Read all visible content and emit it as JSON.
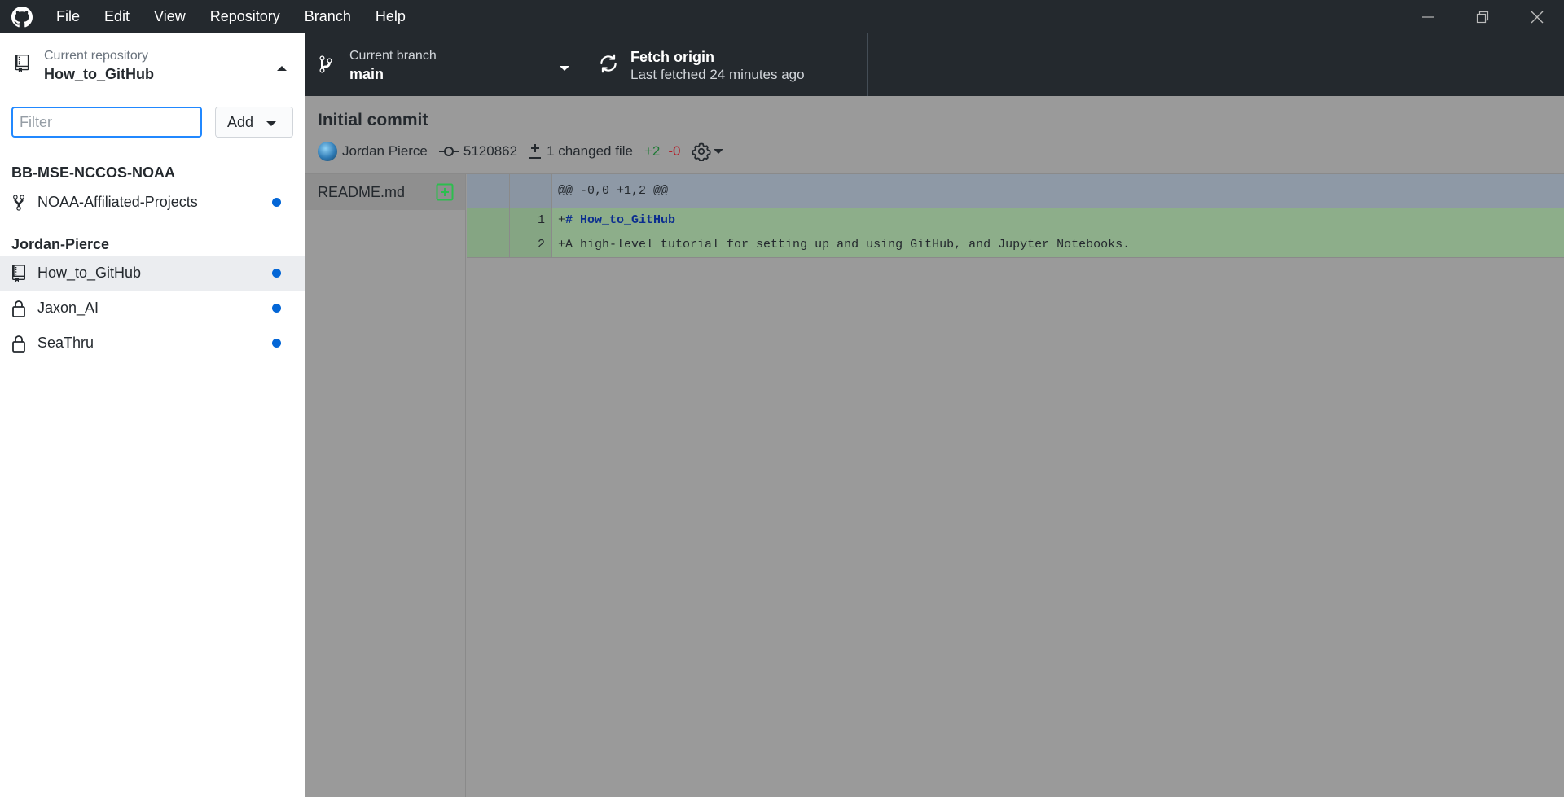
{
  "menu": [
    "File",
    "Edit",
    "View",
    "Repository",
    "Branch",
    "Help"
  ],
  "toolbar": {
    "repo_label": "Current repository",
    "repo_value": "How_to_GitHub",
    "branch_label": "Current branch",
    "branch_value": "main",
    "fetch_title": "Fetch origin",
    "fetch_sub": "Last fetched 24 minutes ago"
  },
  "sidebar": {
    "filter_placeholder": "Filter",
    "add_label": "Add",
    "groups": [
      {
        "name": "BB-MSE-NCCOS-NOAA",
        "repos": [
          {
            "name": "NOAA-Affiliated-Projects",
            "icon": "fork-icon"
          }
        ]
      },
      {
        "name": "Jordan-Pierce",
        "repos": [
          {
            "name": "How_to_GitHub",
            "icon": "repo-icon"
          },
          {
            "name": "Jaxon_AI",
            "icon": "lock-icon"
          },
          {
            "name": "SeaThru",
            "icon": "lock-icon"
          }
        ]
      }
    ]
  },
  "commit": {
    "title": "Initial commit",
    "author": "Jordan Pierce",
    "sha": "5120862",
    "changed": "1 changed file",
    "plus": "+2",
    "minus": "-0"
  },
  "files": [
    {
      "name": "README.md"
    }
  ],
  "diff": {
    "hunk": "@@ -0,0 +1,2 @@",
    "lines": [
      {
        "num": "1",
        "prefix": "+",
        "text": "# How_to_GitHub"
      },
      {
        "num": "2",
        "prefix": "+",
        "text": "A high-level tutorial for setting up and using GitHub, and Jupyter Notebooks."
      }
    ]
  },
  "colors": {
    "accent": "#0366d6",
    "titlebar": "#24292e",
    "added": "#2cbe4e"
  }
}
